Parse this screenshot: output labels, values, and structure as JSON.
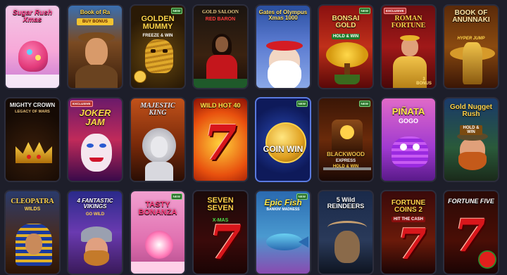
{
  "badge_new": "NEW",
  "badge_exclusive": "EXCLUSIVE",
  "rows": [
    [
      {
        "title": "Sugar Rush Xmas"
      },
      {
        "title": "Book of Ra",
        "subtitle": "BUY BONUS"
      },
      {
        "title": "GOLDEN MUMMY",
        "subtitle": "FREEZE & WIN",
        "new": true
      },
      {
        "title": "GOLD SALOON",
        "subtitle": "RED BARON"
      },
      {
        "title": "Gates of Olympus Xmas 1000"
      },
      {
        "title": "BONSAI GOLD",
        "subtitle": "HOLD & WIN",
        "new": true
      },
      {
        "title": "ROMAN FORTUNE",
        "subtitle": "3 BONUS",
        "exclusive": true
      },
      {
        "title": "BOOK OF ANUNNAKI",
        "subtitle": "HYPER JUMP"
      }
    ],
    [
      {
        "title": "MIGHTY CROWN",
        "subtitle": "LEGACY OF MARS"
      },
      {
        "title": "JOKER JAM",
        "exclusive": true
      },
      {
        "title": "MAJESTIC KING"
      },
      {
        "title": "WILD HOT 40"
      },
      {
        "title": "COIN WIN",
        "new": true
      },
      {
        "title": "BLACKWOOD",
        "subtitle": "EXPRESS",
        "extra": "HOLD & WIN",
        "new": true
      },
      {
        "title": "PIÑATA",
        "subtitle": "GOGO"
      },
      {
        "title": "Gold Nugget Rush",
        "subtitle": "HOLD & WIN"
      }
    ],
    [
      {
        "title": "CLEOPATRA",
        "subtitle": "WILDS"
      },
      {
        "title": "4 FANTASTIC VIKINGS",
        "subtitle": "GO WILD"
      },
      {
        "title": "TASTY BONANZA",
        "new": true
      },
      {
        "title": "SEVEN SEVEN",
        "subtitle": "X-MAS"
      },
      {
        "title": "Epic Fish",
        "subtitle": "BANKIN' MADNESS",
        "new": true
      },
      {
        "title": "5 Wild REINDEERS"
      },
      {
        "title": "FORTUNE COINS 2",
        "subtitle": "HIT THE CASH"
      },
      {
        "title": "FORTUNE FIVE"
      }
    ]
  ]
}
